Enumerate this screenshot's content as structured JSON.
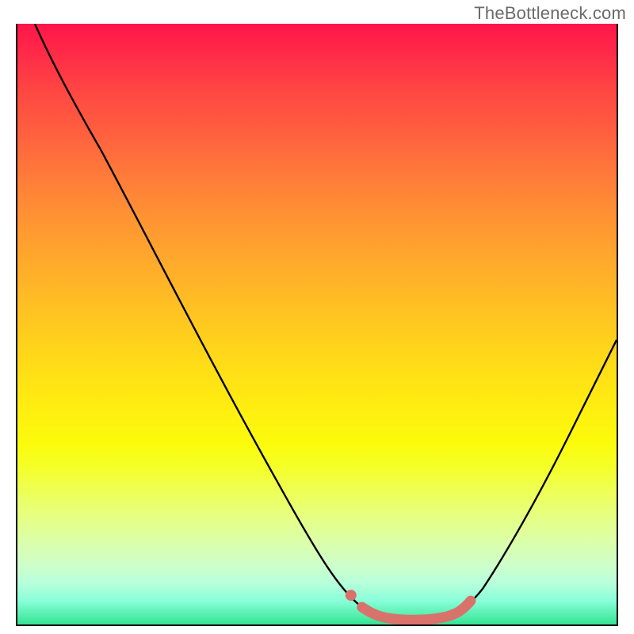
{
  "watermark": "TheBottleneck.com",
  "chart_data": {
    "type": "line",
    "title": "",
    "xlabel": "",
    "ylabel": "",
    "xlim": [
      0,
      100
    ],
    "ylim": [
      0,
      100
    ],
    "gradient_stops": [
      {
        "pos": 0,
        "color": "#ff154a"
      },
      {
        "pos": 25,
        "color": "#ff7a3a"
      },
      {
        "pos": 50,
        "color": "#ffc822"
      },
      {
        "pos": 75,
        "color": "#f0ff3f"
      },
      {
        "pos": 92,
        "color": "#c8ffcf"
      },
      {
        "pos": 100,
        "color": "#33e492"
      }
    ],
    "series": [
      {
        "name": "bottleneck-curve",
        "color": "#000000",
        "points": [
          {
            "x": 3,
            "y": 100
          },
          {
            "x": 8,
            "y": 94
          },
          {
            "x": 14,
            "y": 85
          },
          {
            "x": 22,
            "y": 70
          },
          {
            "x": 30,
            "y": 55
          },
          {
            "x": 38,
            "y": 40
          },
          {
            "x": 46,
            "y": 24
          },
          {
            "x": 52,
            "y": 12
          },
          {
            "x": 56,
            "y": 6
          },
          {
            "x": 58,
            "y": 3
          },
          {
            "x": 60,
            "y": 1.5
          },
          {
            "x": 63,
            "y": 0.8
          },
          {
            "x": 66,
            "y": 0.6
          },
          {
            "x": 70,
            "y": 0.8
          },
          {
            "x": 73,
            "y": 1.4
          },
          {
            "x": 76,
            "y": 3
          },
          {
            "x": 80,
            "y": 8
          },
          {
            "x": 85,
            "y": 16
          },
          {
            "x": 90,
            "y": 26
          },
          {
            "x": 95,
            "y": 36
          },
          {
            "x": 100,
            "y": 46
          }
        ]
      },
      {
        "name": "optimal-range-highlight",
        "color": "#d9726a",
        "points": [
          {
            "x": 57.5,
            "y": 3.5
          },
          {
            "x": 60,
            "y": 1.5
          },
          {
            "x": 63,
            "y": 0.8
          },
          {
            "x": 66,
            "y": 0.6
          },
          {
            "x": 70,
            "y": 0.8
          },
          {
            "x": 73,
            "y": 1.4
          },
          {
            "x": 75.5,
            "y": 3.2
          }
        ]
      },
      {
        "name": "optimal-marker-dot",
        "color": "#d9726a",
        "points": [
          {
            "x": 56,
            "y": 5
          }
        ]
      }
    ]
  }
}
